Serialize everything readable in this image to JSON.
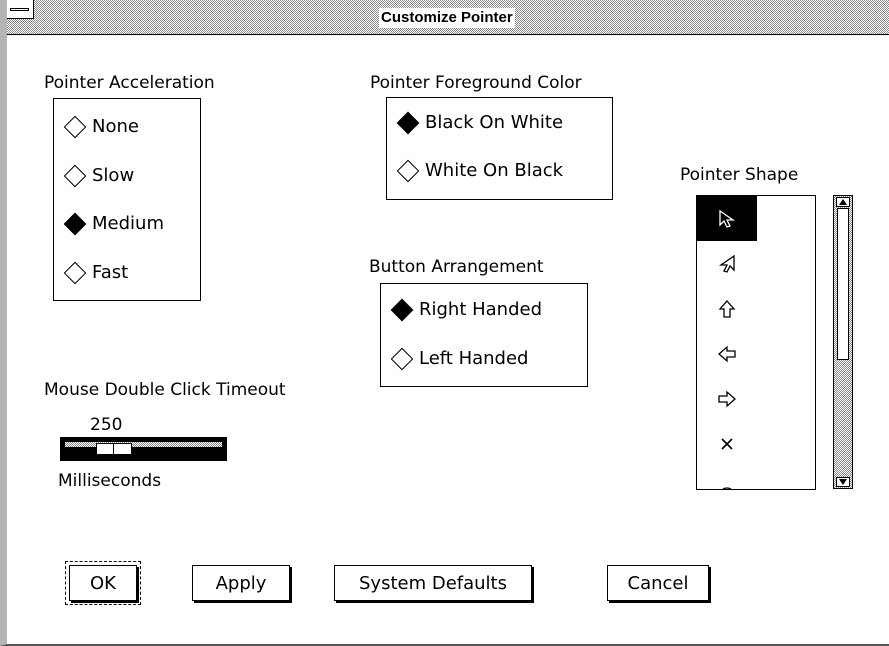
{
  "window": {
    "title": "Customize Pointer"
  },
  "acceleration": {
    "label": "Pointer Acceleration",
    "options": [
      "None",
      "Slow",
      "Medium",
      "Fast"
    ],
    "selected": "Medium"
  },
  "foreground": {
    "label": "Pointer Foreground Color",
    "options": [
      "Black On White",
      "White On Black"
    ],
    "selected": "Black On White"
  },
  "arrangement": {
    "label": "Button Arrangement",
    "options": [
      "Right Handed",
      "Left Handed"
    ],
    "selected": "Right Handed"
  },
  "double_click": {
    "label": "Mouse Double Click Timeout",
    "value": "250",
    "unit": "Milliseconds"
  },
  "shape": {
    "label": "Pointer Shape",
    "items": [
      "arrow-nw-icon",
      "arrow-ne-icon",
      "arrow-up-icon",
      "arrow-left-icon",
      "arrow-right-icon",
      "x-cursor-icon",
      "circle-cursor-icon"
    ],
    "selected_index": 0
  },
  "buttons": {
    "ok": "OK",
    "apply": "Apply",
    "defaults": "System Defaults",
    "cancel": "Cancel"
  }
}
